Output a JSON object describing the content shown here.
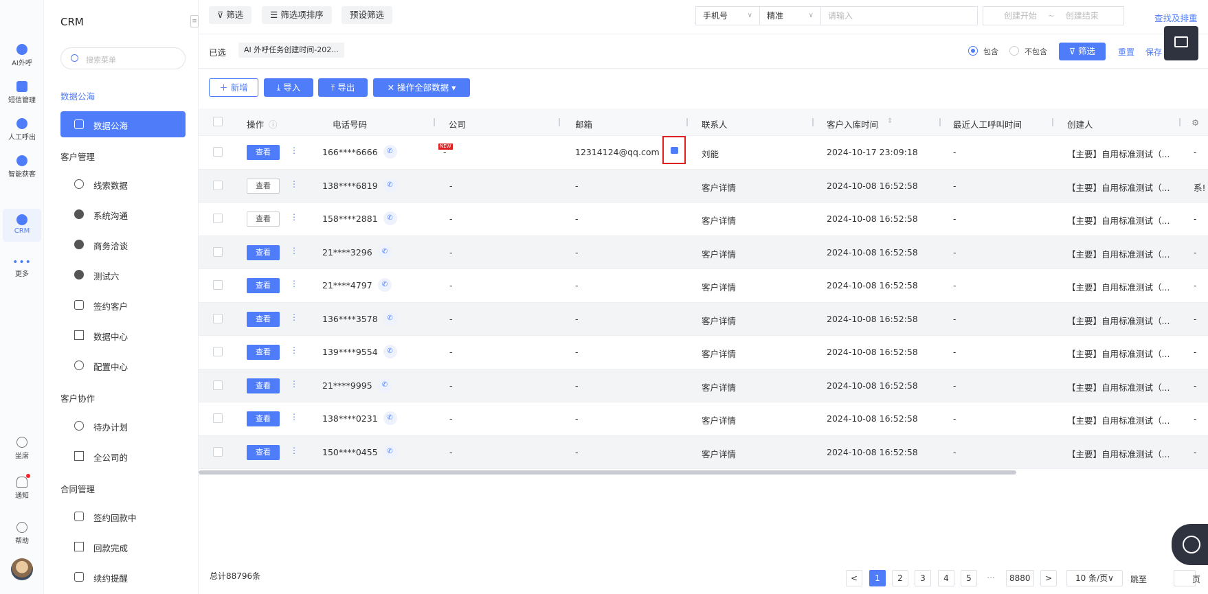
{
  "rail": {
    "items": [
      {
        "label": "AI外呼",
        "icon": "robot-icon"
      },
      {
        "label": "短信管理",
        "icon": "message-icon"
      },
      {
        "label": "人工呼出",
        "icon": "call-icon"
      },
      {
        "label": "智能获客",
        "icon": "target-icon"
      },
      {
        "label": "CRM",
        "icon": "crm-icon"
      },
      {
        "label": "更多",
        "icon": "more-icon"
      }
    ],
    "bottom": [
      {
        "label": "坐席",
        "icon": "headset-icon"
      },
      {
        "label": "通知",
        "icon": "bell-icon"
      },
      {
        "label": "帮助",
        "icon": "help-icon"
      }
    ]
  },
  "menu": {
    "title": "CRM",
    "search_placeholder": "搜索菜单",
    "group1": "数据公海",
    "item_public": "数据公海",
    "group2": "客户管理",
    "items_customer": [
      "线索数据",
      "系统沟通",
      "商务洽谈",
      "测试六",
      "签约客户",
      "数据中心",
      "配置中心"
    ],
    "group3": "客户协作",
    "items_collab": [
      "待办计划",
      "全公司的"
    ],
    "group4": "合同管理",
    "items_contract": [
      "签约回款中",
      "回款完成",
      "续约提醒"
    ]
  },
  "filterbar": {
    "filter": "筛选",
    "sort": "筛选项排序",
    "preset": "预设筛选",
    "field": "手机号",
    "mode": "精准",
    "input_placeholder": "请输入",
    "date_start": "创建开始",
    "date_sep": "~",
    "date_end": "创建结束",
    "find_dedup": "查找及排重"
  },
  "selected": {
    "label": "已选",
    "tag": "AI 外呼任务创建时间-202...",
    "include": "包含",
    "exclude": "不包含",
    "filter_btn": "筛选",
    "reset": "重置",
    "save": "保存"
  },
  "toolbar": {
    "add": "新增",
    "import": "导入",
    "export": "导出",
    "bulk": "操作全部数据"
  },
  "table": {
    "headers": [
      "操作",
      "电话号码",
      "公司",
      "邮箱",
      "联系人",
      "客户入库时间",
      "最近人工呼叫时间",
      "创建人"
    ],
    "view_label": "查看",
    "rows": [
      {
        "phone": "166****6666",
        "company": "-",
        "email": "12314124@qq.com",
        "contact": "刘能",
        "time": "2024-10-17 23:09:18",
        "last_call": "-",
        "creator": "【主要】自用标准测试（...",
        "extra": "-"
      },
      {
        "phone": "138****6819",
        "company": "-",
        "email": "-",
        "contact": "客户详情",
        "time": "2024-10-08 16:52:58",
        "last_call": "-",
        "creator": "【主要】自用标准测试（...",
        "extra": "系!"
      },
      {
        "phone": "158****2881",
        "company": "-",
        "email": "-",
        "contact": "客户详情",
        "time": "2024-10-08 16:52:58",
        "last_call": "-",
        "creator": "【主要】自用标准测试（...",
        "extra": "-"
      },
      {
        "phone": "21****3296",
        "company": "-",
        "email": "-",
        "contact": "客户详情",
        "time": "2024-10-08 16:52:58",
        "last_call": "-",
        "creator": "【主要】自用标准测试（...",
        "extra": "-"
      },
      {
        "phone": "21****4797",
        "company": "-",
        "email": "-",
        "contact": "客户详情",
        "time": "2024-10-08 16:52:58",
        "last_call": "-",
        "creator": "【主要】自用标准测试（...",
        "extra": "-"
      },
      {
        "phone": "136****3578",
        "company": "-",
        "email": "-",
        "contact": "客户详情",
        "time": "2024-10-08 16:52:58",
        "last_call": "-",
        "creator": "【主要】自用标准测试（...",
        "extra": "-"
      },
      {
        "phone": "139****9554",
        "company": "-",
        "email": "-",
        "contact": "客户详情",
        "time": "2024-10-08 16:52:58",
        "last_call": "-",
        "creator": "【主要】自用标准测试（...",
        "extra": "-"
      },
      {
        "phone": "21****9995",
        "company": "-",
        "email": "-",
        "contact": "客户详情",
        "time": "2024-10-08 16:52:58",
        "last_call": "-",
        "creator": "【主要】自用标准测试（...",
        "extra": "-"
      },
      {
        "phone": "138****0231",
        "company": "-",
        "email": "-",
        "contact": "客户详情",
        "time": "2024-10-08 16:52:58",
        "last_call": "-",
        "creator": "【主要】自用标准测试（...",
        "extra": "-"
      },
      {
        "phone": "150****0455",
        "company": "-",
        "email": "-",
        "contact": "客户详情",
        "time": "2024-10-08 16:52:58",
        "last_call": "-",
        "creator": "【主要】自用标准测试（...",
        "extra": "-"
      }
    ],
    "view_styles": [
      "solid",
      "ghost",
      "ghost",
      "solid",
      "solid",
      "solid",
      "solid",
      "solid",
      "solid",
      "solid"
    ],
    "new_badge": "NEW"
  },
  "footer": {
    "total": "总计88796条",
    "pages": [
      "1",
      "2",
      "3",
      "4",
      "5"
    ],
    "ellipsis": "···",
    "last_page": "8880",
    "page_size": "10 条/页",
    "jump": "跳至",
    "page_unit": "页"
  },
  "colors": {
    "primary": "#4f7df9",
    "highlight": "#e02020"
  }
}
